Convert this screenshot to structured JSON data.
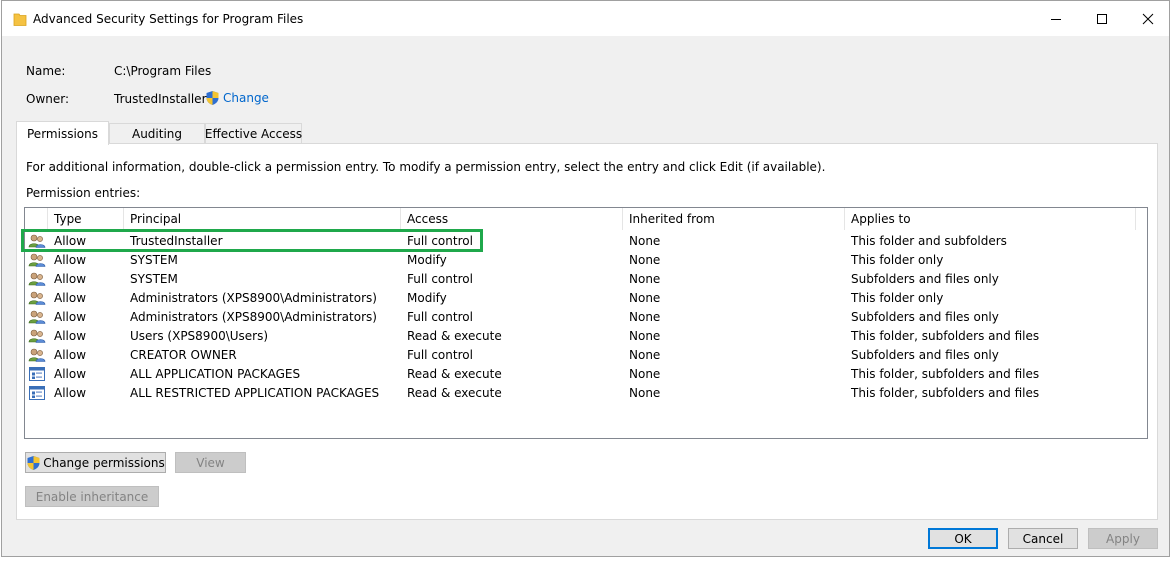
{
  "window": {
    "title": "Advanced Security Settings for Program Files"
  },
  "info": {
    "name_label": "Name:",
    "name_value": "C:\\Program Files",
    "owner_label": "Owner:",
    "owner_value": "TrustedInstaller",
    "change_link": "Change"
  },
  "tabs": [
    {
      "label": "Permissions",
      "active": true
    },
    {
      "label": "Auditing",
      "active": false
    },
    {
      "label": "Effective Access",
      "active": false
    }
  ],
  "instructions": "For additional information, double-click a permission entry. To modify a permission entry, select the entry and click Edit (if available).",
  "entries_label": "Permission entries:",
  "columns": [
    "Type",
    "Principal",
    "Access",
    "Inherited from",
    "Applies to"
  ],
  "rows": [
    {
      "icon": "users-icon",
      "type": "Allow",
      "principal": "TrustedInstaller",
      "access": "Full control",
      "inherited": "None",
      "applies": "This folder and subfolders"
    },
    {
      "icon": "users-icon",
      "type": "Allow",
      "principal": "SYSTEM",
      "access": "Modify",
      "inherited": "None",
      "applies": "This folder only"
    },
    {
      "icon": "users-icon",
      "type": "Allow",
      "principal": "SYSTEM",
      "access": "Full control",
      "inherited": "None",
      "applies": "Subfolders and files only"
    },
    {
      "icon": "users-icon",
      "type": "Allow",
      "principal": "Administrators (XPS8900\\Administrators)",
      "access": "Modify",
      "inherited": "None",
      "applies": "This folder only"
    },
    {
      "icon": "users-icon",
      "type": "Allow",
      "principal": "Administrators (XPS8900\\Administrators)",
      "access": "Full control",
      "inherited": "None",
      "applies": "Subfolders and files only"
    },
    {
      "icon": "users-icon",
      "type": "Allow",
      "principal": "Users (XPS8900\\Users)",
      "access": "Read & execute",
      "inherited": "None",
      "applies": "This folder, subfolders and files"
    },
    {
      "icon": "users-icon",
      "type": "Allow",
      "principal": "CREATOR OWNER",
      "access": "Full control",
      "inherited": "None",
      "applies": "Subfolders and files only"
    },
    {
      "icon": "app-packages-icon",
      "type": "Allow",
      "principal": "ALL APPLICATION PACKAGES",
      "access": "Read & execute",
      "inherited": "None",
      "applies": "This folder, subfolders and files"
    },
    {
      "icon": "app-packages-icon",
      "type": "Allow",
      "principal": "ALL RESTRICTED APPLICATION PACKAGES",
      "access": "Read & execute",
      "inherited": "None",
      "applies": "This folder, subfolders and files"
    }
  ],
  "buttons": {
    "change_permissions": "Change permissions",
    "view": "View",
    "enable_inheritance": "Enable inheritance",
    "ok": "OK",
    "cancel": "Cancel",
    "apply": "Apply"
  },
  "colors": {
    "highlight": "#1fa84b",
    "link": "#0066cc",
    "default_button_border": "#0078d7"
  }
}
